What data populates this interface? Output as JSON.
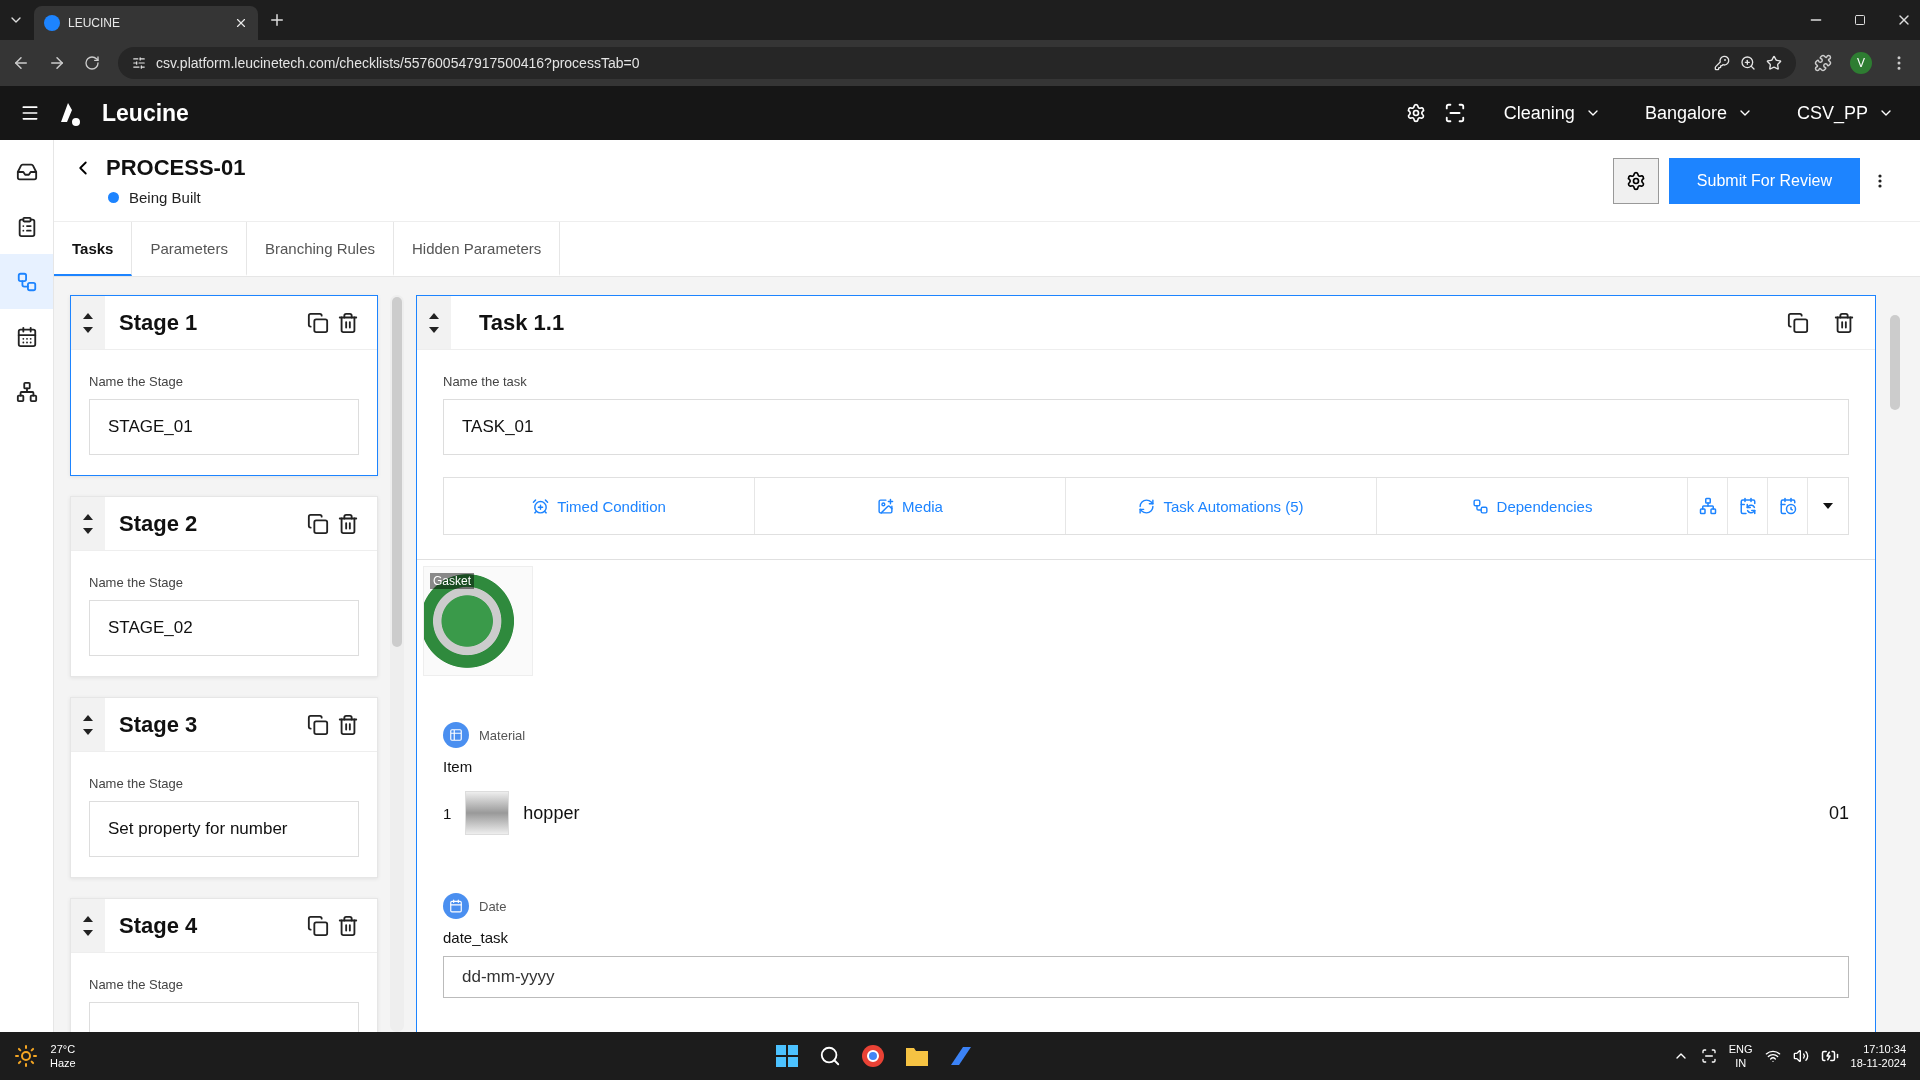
{
  "browser": {
    "tab_title": "LEUCINE",
    "url": "csv.platform.leucinetech.com/checklists/557600547917500416?processTab=0",
    "profile": "V"
  },
  "app_header": {
    "brand": "Leucine",
    "dropdowns": [
      "Cleaning",
      "Bangalore",
      "CSV_PP"
    ]
  },
  "nav_rail": [
    {
      "kind": "inbox",
      "selected": false
    },
    {
      "kind": "checklist",
      "selected": false
    },
    {
      "kind": "process",
      "selected": true
    },
    {
      "kind": "calendar",
      "selected": false
    },
    {
      "kind": "hierarchy",
      "selected": false
    }
  ],
  "process": {
    "title": "PROCESS-01",
    "status": "Being Built",
    "submit_label": "Submit For Review"
  },
  "tabs": [
    {
      "label": "Tasks",
      "selected": true
    },
    {
      "label": "Parameters",
      "selected": false
    },
    {
      "label": "Branching Rules",
      "selected": false
    },
    {
      "label": "Hidden Parameters",
      "selected": false
    }
  ],
  "stages": [
    {
      "title": "Stage 1",
      "field_label": "Name the Stage",
      "value": "STAGE_01",
      "selected": true
    },
    {
      "title": "Stage 2",
      "field_label": "Name the Stage",
      "value": "STAGE_02",
      "selected": false
    },
    {
      "title": "Stage 3",
      "field_label": "Name the Stage",
      "value": "Set property for number",
      "selected": false
    },
    {
      "title": "Stage 4",
      "field_label": "Name the Stage",
      "selected": false
    }
  ],
  "task": {
    "title": "Task 1.1",
    "field_label": "Name the task",
    "value": "TASK_01",
    "actions": [
      {
        "kind": "timed",
        "label": "Timed Condition"
      },
      {
        "kind": "media",
        "label": "Media"
      },
      {
        "kind": "automation",
        "label": "Task Automations (5)"
      },
      {
        "kind": "dependencies",
        "label": "Dependencies"
      }
    ],
    "tool_icons": [
      {
        "kind": "hierarchy"
      },
      {
        "kind": "calendar-sync"
      },
      {
        "kind": "calendar-clock"
      },
      {
        "kind": "more"
      }
    ],
    "media_caption": "Gasket",
    "parameters": [
      {
        "kind": "material",
        "type_label": "Material",
        "label": "Item",
        "rows": [
          {
            "index": "1",
            "name": "hopper",
            "quantity": "01"
          }
        ]
      },
      {
        "kind": "date",
        "type_label": "Date",
        "label": "date_task",
        "placeholder": "dd-mm-yyyy"
      }
    ]
  },
  "taskbar": {
    "temperature": "27°C",
    "weather": "Haze",
    "language": "ENG",
    "region": "IN",
    "time": "17:10:34",
    "date": "18-11-2024"
  }
}
